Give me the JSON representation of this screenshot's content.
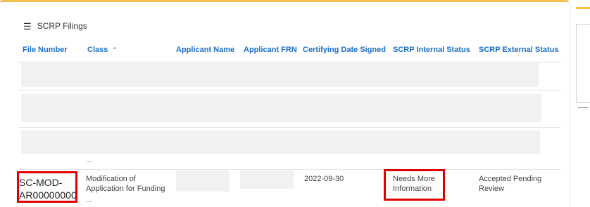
{
  "panel": {
    "title": "SCRP Filings",
    "menu_icon": "hamburger-menu-icon"
  },
  "table": {
    "columns": [
      {
        "label": "File Number"
      },
      {
        "label": "Class",
        "sort_icon": "chevron-up-icon",
        "sort_glyph": "⌃"
      },
      {
        "label": "Applicant Name"
      },
      {
        "label": "Applicant FRN"
      },
      {
        "label": "Certifying Date Signed"
      },
      {
        "label": "SCRP Internal Status"
      },
      {
        "label": "SCRP External Status"
      }
    ],
    "ellipsis": "...",
    "row": {
      "file_number": "SC-MOD-AR00000000",
      "class": "Modification of Application for Funding",
      "class_ellipsis": "...",
      "certifying_date": "2022-09-30",
      "internal_status": "Needs More Information",
      "external_status": "Accepted Pending Review"
    }
  },
  "colors": {
    "accent_top_border": "#f2c14e",
    "header_text": "#1a6ec7",
    "highlight": "#e00000",
    "placeholder": "#f0f1f3"
  }
}
